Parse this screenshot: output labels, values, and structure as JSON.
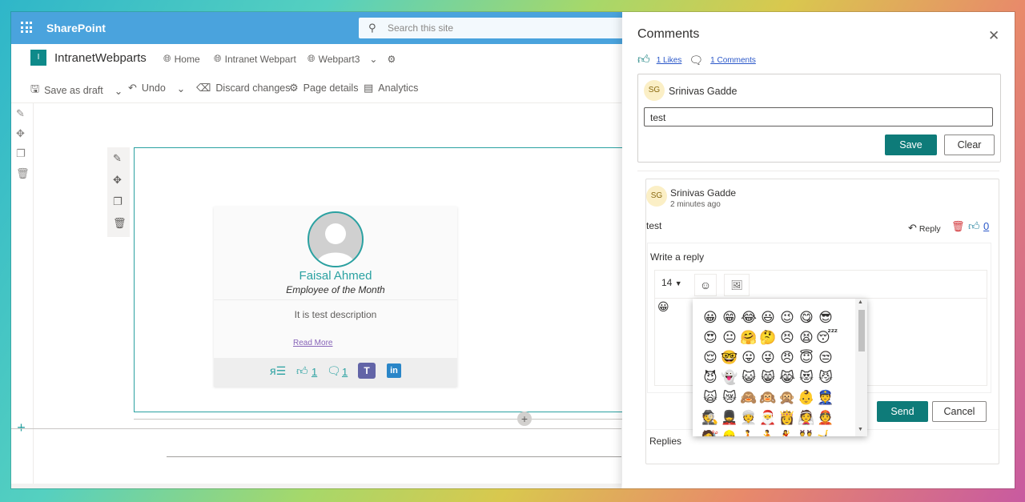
{
  "suite": {
    "app_name": "SharePoint",
    "search_placeholder": "Search this site"
  },
  "site": {
    "logo_letter": "I",
    "name": "IntranetWebparts",
    "nav": [
      {
        "label": "Home"
      },
      {
        "label": "Intranet Webpart"
      },
      {
        "label": "Webpart3"
      }
    ]
  },
  "commandbar": {
    "save_draft": "Save as draft",
    "undo": "Undo",
    "discard": "Discard changes",
    "page_details": "Page details",
    "analytics": "Analytics"
  },
  "card": {
    "name": "Faisal Ahmed",
    "role": "Employee of the Month",
    "description": "It is test description",
    "read_more": "Read More",
    "likes": "1",
    "comments": "1"
  },
  "panel": {
    "title": "Comments",
    "likes_link": "1 Likes",
    "comments_link": "1 Comments",
    "composer": {
      "initials": "SG",
      "user": "Srinivas Gadde",
      "value": "test",
      "save_label": "Save",
      "clear_label": "Clear"
    },
    "comment": {
      "initials": "SG",
      "user": "Srinivas Gadde",
      "time": "2 minutes ago",
      "text": "test",
      "reply_label": "Reply",
      "like_count": "0"
    },
    "reply_box": {
      "label": "Write a reply",
      "font_size": "14",
      "draft_emoji": "😀",
      "send_label": "Send",
      "cancel_label": "Cancel",
      "replies_label": "Replies"
    }
  },
  "emoji_picker": {
    "emojis": [
      "😀",
      "😁",
      "😂",
      "😃",
      "😉",
      "😋",
      "😎",
      "😍",
      "😐",
      "🤗",
      "🤔",
      "😣",
      "😫",
      "😴",
      "😌",
      "🤓",
      "😛",
      "😜",
      "😠",
      "😇",
      "😒",
      "😈",
      "👻",
      "😺",
      "😸",
      "😹",
      "😻",
      "😼",
      "🙀",
      "😿",
      "🙈",
      "🙉",
      "🙊",
      "👶",
      "👮",
      "🕵",
      "💂",
      "👳",
      "🎅",
      "👸",
      "👰",
      "👲",
      "💇",
      "👷",
      "🚶",
      "🏃",
      "💃",
      "👯",
      "🤸"
    ]
  },
  "colors": {
    "accent": "#0e7b79",
    "suitebar": "#4aa3dd",
    "link": "#2b58c9"
  }
}
